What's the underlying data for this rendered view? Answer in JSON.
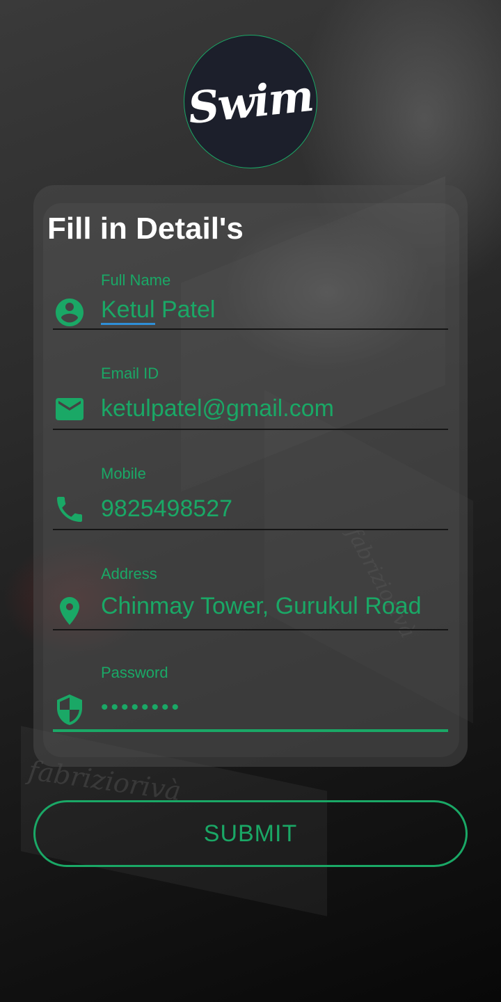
{
  "logo": {
    "text": "Swim"
  },
  "form": {
    "title": "Fill in Detail's",
    "fields": [
      {
        "label": "Full Name",
        "value_underlined": "Ketul",
        "value_rest": " Patel",
        "icon": "account-circle-icon"
      },
      {
        "label": "Email ID",
        "value": "ketulpatel@gmail.com",
        "icon": "mail-icon"
      },
      {
        "label": "Mobile",
        "value": "9825498527",
        "icon": "phone-icon"
      },
      {
        "label": "Address",
        "value": "Chinmay Tower, Gurukul Road",
        "icon": "location-pin-icon"
      },
      {
        "label": "Password",
        "value": "••••••••",
        "icon": "shield-icon"
      }
    ]
  },
  "submit": {
    "label": "SUBMIT"
  },
  "colors": {
    "accent": "#1aa866",
    "spellcheck_underline": "#2f8fd8",
    "logo_bg": "#1c1f2b"
  },
  "background_watermark": "fabriziorivà"
}
